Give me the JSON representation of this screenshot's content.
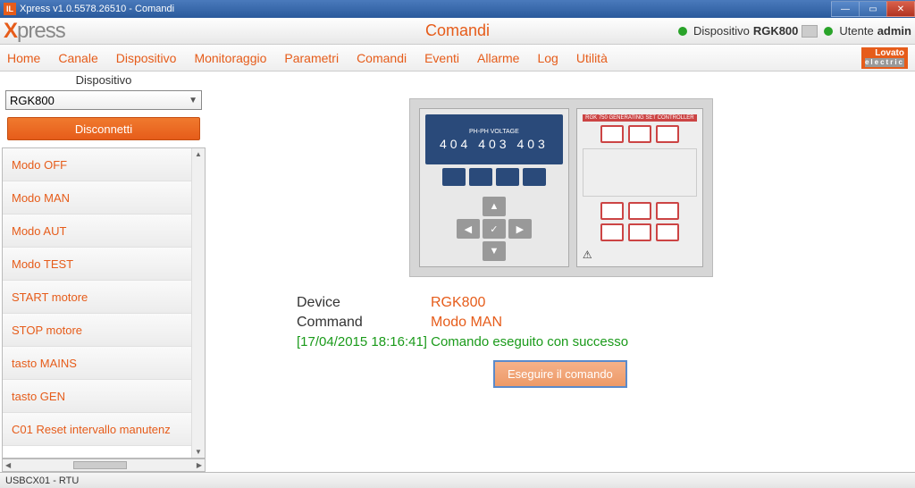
{
  "window": {
    "title": "Xpress v1.0.5578.26510 - Comandi"
  },
  "header": {
    "brand_x": "X",
    "brand_rest": "press",
    "page_title": "Comandi",
    "device_label": "Dispositivo",
    "device_value": "RGK800",
    "user_label": "Utente",
    "user_value": "admin"
  },
  "nav": {
    "items": [
      "Home",
      "Canale",
      "Dispositivo",
      "Monitoraggio",
      "Parametri",
      "Comandi",
      "Eventi",
      "Allarme",
      "Log",
      "Utilità"
    ],
    "logo_top": "Lovato",
    "logo_sub": "electric"
  },
  "sidebar": {
    "title": "Dispositivo",
    "combo_value": "RGK800",
    "disconnect": "Disconnetti",
    "commands": [
      "Modo OFF",
      "Modo MAN",
      "Modo AUT",
      "Modo TEST",
      "START motore",
      "STOP motore",
      "tasto MAINS",
      "tasto GEN",
      "C01 Reset intervallo manutenz"
    ]
  },
  "device_panel": {
    "lcd_top": "PH-PH VOLTAGE",
    "lcd_vals": "404 403 403",
    "keypad_label": "RGK 750 GENERATING SET CONTROLLER"
  },
  "details": {
    "device_label": "Device",
    "device_value": "RGK800",
    "command_label": "Command",
    "command_value": "Modo MAN",
    "success": "[17/04/2015 18:16:41] Comando eseguito con successo",
    "exec_button": "Eseguire il comando"
  },
  "statusbar": {
    "text": "USBCX01 - RTU"
  }
}
